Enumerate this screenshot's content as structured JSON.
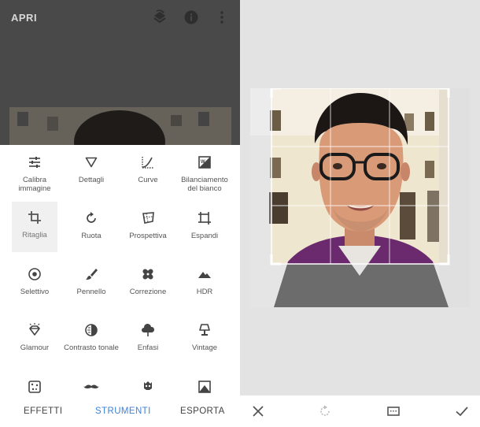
{
  "header": {
    "open_label": "APRI",
    "icons": [
      "layers-icon",
      "info-icon",
      "more-vert-icon"
    ]
  },
  "tools": [
    {
      "label": "Calibra immagine",
      "icon": "sliders-icon"
    },
    {
      "label": "Dettagli",
      "icon": "triangle-icon"
    },
    {
      "label": "Curve",
      "icon": "curve-icon"
    },
    {
      "label": "Bilanciamento del bianco",
      "icon": "white-balance-icon"
    },
    {
      "label": "Ritaglia",
      "icon": "crop-icon",
      "selected": true
    },
    {
      "label": "Ruota",
      "icon": "rotate-icon"
    },
    {
      "label": "Prospettiva",
      "icon": "perspective-icon"
    },
    {
      "label": "Espandi",
      "icon": "expand-icon"
    },
    {
      "label": "Selettivo",
      "icon": "target-icon"
    },
    {
      "label": "Pennello",
      "icon": "brush-icon"
    },
    {
      "label": "Correzione",
      "icon": "bandage-icon"
    },
    {
      "label": "HDR",
      "icon": "mountain-icon"
    },
    {
      "label": "Glamour",
      "icon": "diamond-icon"
    },
    {
      "label": "Contrasto tonale",
      "icon": "contrast-icon"
    },
    {
      "label": "Enfasi",
      "icon": "cloud-icon"
    },
    {
      "label": "Vintage",
      "icon": "lamp-icon"
    },
    {
      "label": "",
      "icon": "grunge-icon"
    },
    {
      "label": "",
      "icon": "mustache-icon"
    },
    {
      "label": "",
      "icon": "skull-icon"
    },
    {
      "label": "",
      "icon": "noir-icon"
    }
  ],
  "bottom_tabs": {
    "effects": "EFFETTI",
    "tools": "STRUMENTI",
    "export": "ESPORTA",
    "active": "STRUMENTI"
  },
  "editor_toolbar": {
    "icons": [
      "close-icon",
      "rotate-icon",
      "aspect-ratio-icon",
      "check-icon"
    ]
  },
  "colors": {
    "accent": "#3f82d6",
    "header_bg": "#494949",
    "editor_bg": "#e3e3e3"
  }
}
